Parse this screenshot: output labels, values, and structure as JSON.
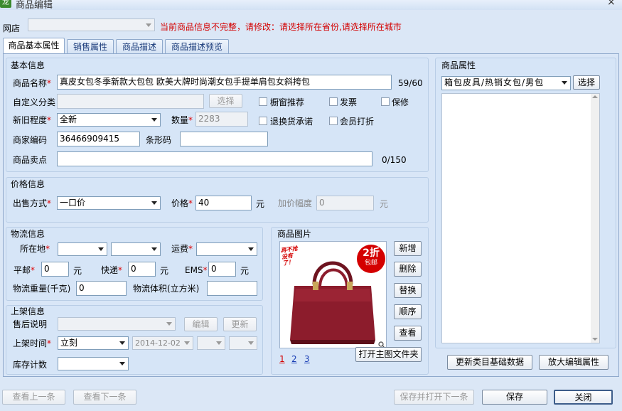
{
  "window": {
    "title": "商品编辑",
    "app_icon": "龙",
    "close_glyph": "×"
  },
  "shop": {
    "label": "网店",
    "value": "",
    "error": "当前商品信息不完整，请修改：请选择所在省份,请选择所在城市"
  },
  "tabs": [
    {
      "label": "商品基本属性",
      "active": true
    },
    {
      "label": "销售属性",
      "active": false
    },
    {
      "label": "商品描述",
      "active": false
    },
    {
      "label": "商品描述预览",
      "active": false
    }
  ],
  "basic": {
    "section": "基本信息",
    "name_label": "商品名称",
    "name_value": "真皮女包冬季新款大包包 欧美大牌时尚潮女包手提单肩包女斜挎包",
    "name_count": "59/60",
    "custom_cat_label": "自定义分类",
    "custom_cat_value": "",
    "select_btn": "选择",
    "chk_window": "橱窗推荐",
    "chk_invoice": "发票",
    "chk_warranty": "保修",
    "condition_label": "新旧程度",
    "condition_value": "全新",
    "qty_label": "数量",
    "qty_value": "2283",
    "chk_return": "退换货承诺",
    "chk_member": "会员打折",
    "code_label": "商家编码",
    "code_value": "36466909415",
    "barcode_label": "条形码",
    "barcode_value": "",
    "selling_label": "商品卖点",
    "selling_value": "",
    "selling_count": "0/150"
  },
  "price": {
    "section": "价格信息",
    "method_label": "出售方式",
    "method_value": "一口价",
    "price_label": "价格",
    "price_value": "40",
    "unit": "元",
    "markup_label": "加价幅度",
    "markup_value": "0",
    "markup_unit": "元"
  },
  "logistics": {
    "section": "物流信息",
    "location_label": "所在地",
    "freight_label": "运费",
    "post_label": "平邮",
    "post_value": "0",
    "express_label": "快递",
    "express_value": "0",
    "ems_label": "EMS",
    "ems_value": "0",
    "unit": "元",
    "weight_label": "物流重量(千克)",
    "weight_value": "0",
    "volume_label": "物流体积(立方米)",
    "volume_value": ""
  },
  "shelf": {
    "section": "上架信息",
    "aftersale_label": "售后说明",
    "aftersale_value": "",
    "edit_btn": "编辑",
    "update_btn": "更新",
    "time_label": "上架时间",
    "time_value": "立刻",
    "date_value": "2014-12-02",
    "stock_label": "库存计数",
    "stock_value": ""
  },
  "images": {
    "section": "商品图片",
    "badge_left": "再不抢 没有了！",
    "badge_right_top": "2折",
    "badge_right_bottom": "包邮",
    "buttons": [
      "新增",
      "删除",
      "替换",
      "顺序",
      "查看"
    ],
    "open_folder": "打开主图文件夹",
    "pages": [
      "1",
      "2",
      "3"
    ]
  },
  "attributes": {
    "section": "商品属性",
    "category_value": "箱包皮具/热销女包/男包",
    "select_btn": "选择",
    "update_btn": "更新类目基础数据",
    "zoom_btn": "放大编辑属性"
  },
  "footer": {
    "prev": "查看上一条",
    "next": "查看下一条",
    "save_next": "保存并打开下一条",
    "save": "保存",
    "close": "关闭"
  },
  "colors": {
    "accent": "#d40000",
    "bg": "#dbe7f6",
    "bag": "#8c1c2c"
  }
}
